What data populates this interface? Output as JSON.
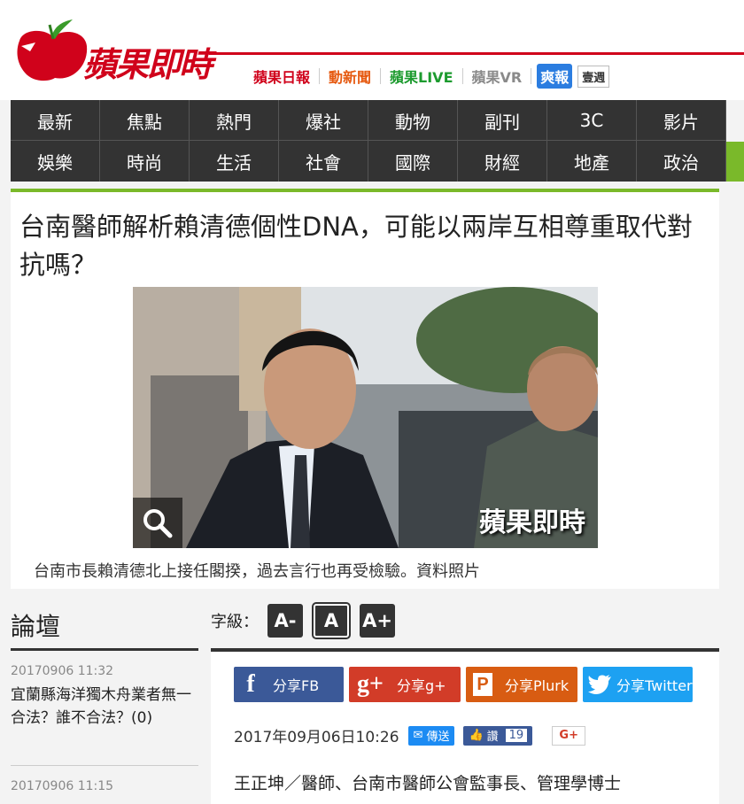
{
  "header": {
    "logo_text": "蘋果即時",
    "brands": [
      "蘋果日報",
      "動新聞",
      "蘋果LIVE",
      "蘋果VR",
      "爽報",
      "壹週"
    ]
  },
  "nav": {
    "row1": [
      "最新",
      "焦點",
      "熱門",
      "爆社",
      "動物",
      "副刊",
      "3C",
      "影片"
    ],
    "row2": [
      "娛樂",
      "時尚",
      "生活",
      "社會",
      "國際",
      "財經",
      "地產",
      "政治"
    ]
  },
  "article": {
    "title": "台南醫師解析賴清德個性DNA，可能以兩岸互相尊重取代對抗嗎？",
    "photo_watermark": "蘋果即時",
    "caption": "台南市長賴清德北上接任閣揆，過去言行也再受檢驗。資料照片",
    "date": "2017年09月06日10:26",
    "author": "王正坤／醫師、台南市醫師公會監事長、管理學博士"
  },
  "fontsize": {
    "label": "字級：",
    "small": "A-",
    "normal": "A",
    "large": "A+"
  },
  "share": {
    "fb": "分享FB",
    "gplus": "分享g+",
    "plurk": "分享Plurk",
    "twitter": "分享Twitter",
    "message": "傳送",
    "like_label": "讚",
    "like_count": "19",
    "gplus_small": "G+"
  },
  "forum": {
    "title": "論壇",
    "items": [
      {
        "date": "20170906 11:32",
        "text": "宜蘭縣海洋獨木舟業者無一合法？誰不合法？(0)"
      },
      {
        "date": "20170906 11:15",
        "text": ""
      }
    ]
  },
  "colors": {
    "brand_red": "#d0021b",
    "nav_bg": "#333333",
    "accent_green": "#7ab92a"
  }
}
